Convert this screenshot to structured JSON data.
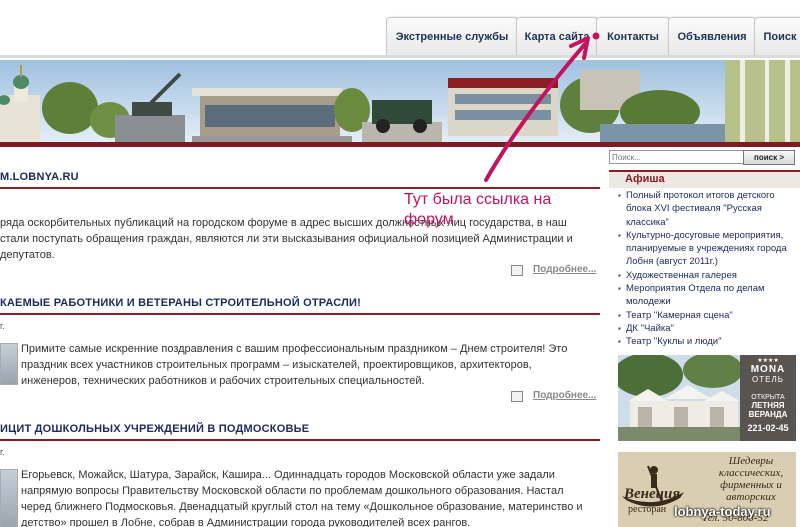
{
  "nav": {
    "tabs": [
      {
        "label": "Экстренные службы"
      },
      {
        "label": "Карта сайта"
      },
      {
        "label": "Контакты"
      },
      {
        "label": "Объявления"
      },
      {
        "label": "Поиск"
      }
    ]
  },
  "main": {
    "articles": [
      {
        "title": "M.LOBNYA.RU",
        "date": "",
        "text": "ряда оскорбительных публикаций на городском форуме в адрес высших должностных лиц государства, в наш стали поступать обращения граждан, являются ли эти высказывания официальной позицией Администрации и депутатов.",
        "more": "Подробнее..."
      },
      {
        "title": "КАЕМЫЕ РАБОТНИКИ И ВЕТЕРАНЫ СТРОИТЕЛЬНОЙ ОТРАСЛИ!",
        "date": "г.",
        "text": "Примите самые искренние поздравления с вашим профессиональным праздником – Днем строителя! Это праздник всех участников строительных программ – изыскателей, проектировщиков, архитекторов, инженеров, технических работников и рабочих строительных специальностей.",
        "more": "Подробнее..."
      },
      {
        "title": "ИЦИТ ДОШКОЛЬНЫХ УЧРЕЖДЕНИЙ В ПОДМОСКОВЬЕ",
        "date": "г.",
        "text": "Егорьевск, Можайск, Шатура, Зарайск, Кашира... Одиннадцать городов Московской области уже задали напрямую вопросы Правительству Московской области по проблемам дошкольного образования. Настал черед ближнего Подмосковья. Двенадцатый круглый стол на тему «Дошкольное образование, материнство и детство» прошел в Лобне, собрав в Администрации города руководителей всех рангов.",
        "more": ""
      }
    ],
    "first_date": "г."
  },
  "sidebar": {
    "search": {
      "placeholder": "Поиск...",
      "button": "поиск >"
    },
    "afisha_title": "Афиша",
    "afisha_items": [
      "Полный протокол итогов детского блока XVI фестиваля \"Русская классика\"",
      "Культурно-досуговые мероприятия, планируемые в учреждениях города Лобня (август 2011г.)",
      "Художественная галерея",
      "Мероприятия Отдела по делам молодежи",
      "Театр \"Камерная сцена\"",
      "ДК \"Чайка\"",
      "Театр \"Куклы и люди\""
    ],
    "ad_mona": {
      "brand": "MONA",
      "sub": "ОТЕЛЬ",
      "line1": "ОТКРЫТА",
      "line2": "ЛЕТНЯЯ",
      "line3": "ВЕРАНДА",
      "phone": "221-02-45"
    },
    "ad_venezia": {
      "name": "Венеция",
      "sub": "ресторан",
      "text": "Шедевры классических, фирменных и авторских",
      "phone": "Тел. 50-808-52"
    }
  },
  "annotation": {
    "text": "Тут была ссылка на форум",
    "color": "#c2135e"
  },
  "watermark": "lobnya-today.ru"
}
